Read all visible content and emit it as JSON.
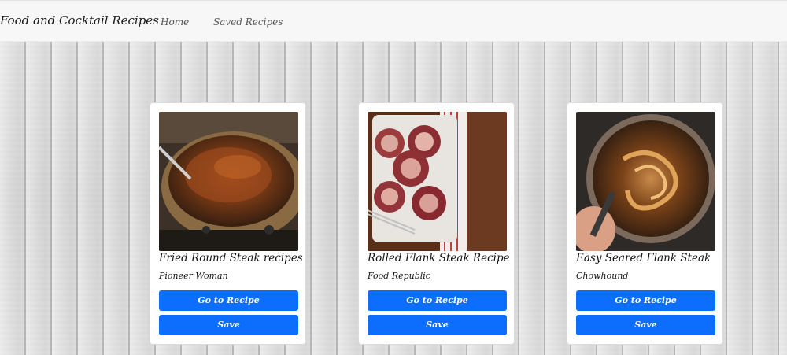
{
  "navbar": {
    "brand": "Food and Cocktail Recipes",
    "links": [
      "Home",
      "Saved Recipes"
    ]
  },
  "cards": [
    {
      "title": "Fried Round Steak recipes",
      "source": "Pioneer Woman",
      "go_label": "Go to Recipe",
      "save_label": "Save"
    },
    {
      "title": "Rolled Flank Steak Recipe",
      "source": "Food Republic",
      "go_label": "Go to Recipe",
      "save_label": "Save"
    },
    {
      "title": "Easy Seared Flank Steak",
      "source": "Chowhound",
      "go_label": "Go to Recipe",
      "save_label": "Save"
    }
  ],
  "colors": {
    "button": "#0d6efd",
    "navbar_bg": "#f7f7f8",
    "card_bg": "#ffffff"
  }
}
